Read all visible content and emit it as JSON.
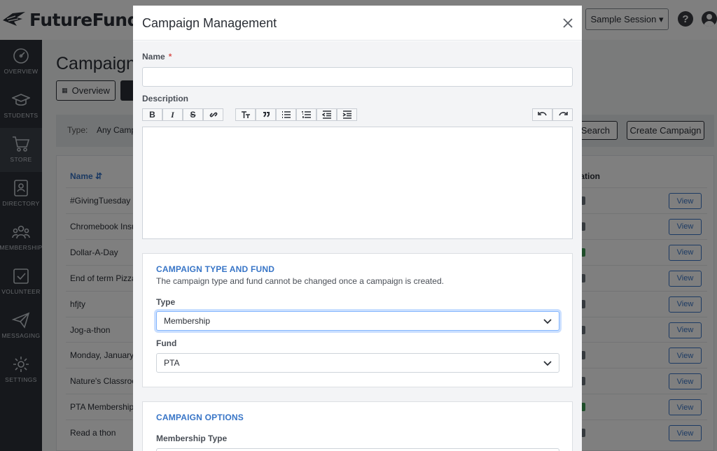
{
  "app": {
    "logo_text": "FutureFund",
    "session_button": "Sample Session ▾",
    "help_icon": "?"
  },
  "sidebar": {
    "items": [
      {
        "label": "OVERVIEW",
        "icon": "dashboard-icon"
      },
      {
        "label": "STUDENTS",
        "icon": "graduation-cap-icon"
      },
      {
        "label": "STORE",
        "icon": "shopping-cart-icon",
        "active": true
      },
      {
        "label": "DIRECTORY",
        "icon": "contact-book-icon"
      },
      {
        "label": "MEMBERSHIP",
        "icon": "people-icon"
      },
      {
        "label": "VOLUNTEER",
        "icon": "checkbox-icon"
      },
      {
        "label": "MESSAGING",
        "icon": "paper-plane-icon"
      },
      {
        "label": "SETTINGS",
        "icon": "gear-icon"
      }
    ]
  },
  "page": {
    "title": "Campaigns",
    "overview_tab": "Overview",
    "filter_type_label": "Type:",
    "filter_type_value": "Any Campa",
    "search_button": "Search",
    "create_button": "Create Campaign",
    "columns": {
      "name": "Name ⇵",
      "registration": "stration"
    },
    "view_label": "View",
    "rows": [
      {
        "name": "#GivingTuesday",
        "registration": "No"
      },
      {
        "name": "Chromebook Insu",
        "registration": "No"
      },
      {
        "name": "Dollar-A-Day",
        "registration": "Yes"
      },
      {
        "name": "End of term Pizza",
        "registration": "No"
      },
      {
        "name": "hfjty",
        "registration": "No"
      },
      {
        "name": "Jog-a-thon",
        "registration": "No"
      },
      {
        "name": "Monday, January",
        "registration": "No"
      },
      {
        "name": "Nature's Classroo",
        "registration": "No"
      },
      {
        "name": "PTA Membership",
        "registration": "Yes"
      },
      {
        "name": "Read a thon",
        "registration": "No"
      }
    ]
  },
  "modal": {
    "title": "Campaign Management",
    "name_label": "Name",
    "required_mark": "*",
    "name_value": "",
    "description_label": "Description",
    "toolbar": {
      "bold": "B",
      "italic": "I",
      "strike": "S",
      "link": "link-icon",
      "heading": "heading-icon",
      "quote": "quote-icon",
      "bullet_list": "bullet-list-icon",
      "numbered_list": "numbered-list-icon",
      "outdent": "outdent-icon",
      "indent": "indent-icon",
      "undo": "undo-icon",
      "redo": "redo-icon"
    },
    "type_fund_section": {
      "title": "CAMPAIGN TYPE AND FUND",
      "note": "The campaign type and fund cannot be changed once a campaign is created.",
      "type_label": "Type",
      "type_value": "Membership",
      "fund_label": "Fund",
      "fund_value": "PTA"
    },
    "options_section": {
      "title": "CAMPAIGN OPTIONS",
      "membership_type_label": "Membership Type"
    }
  }
}
